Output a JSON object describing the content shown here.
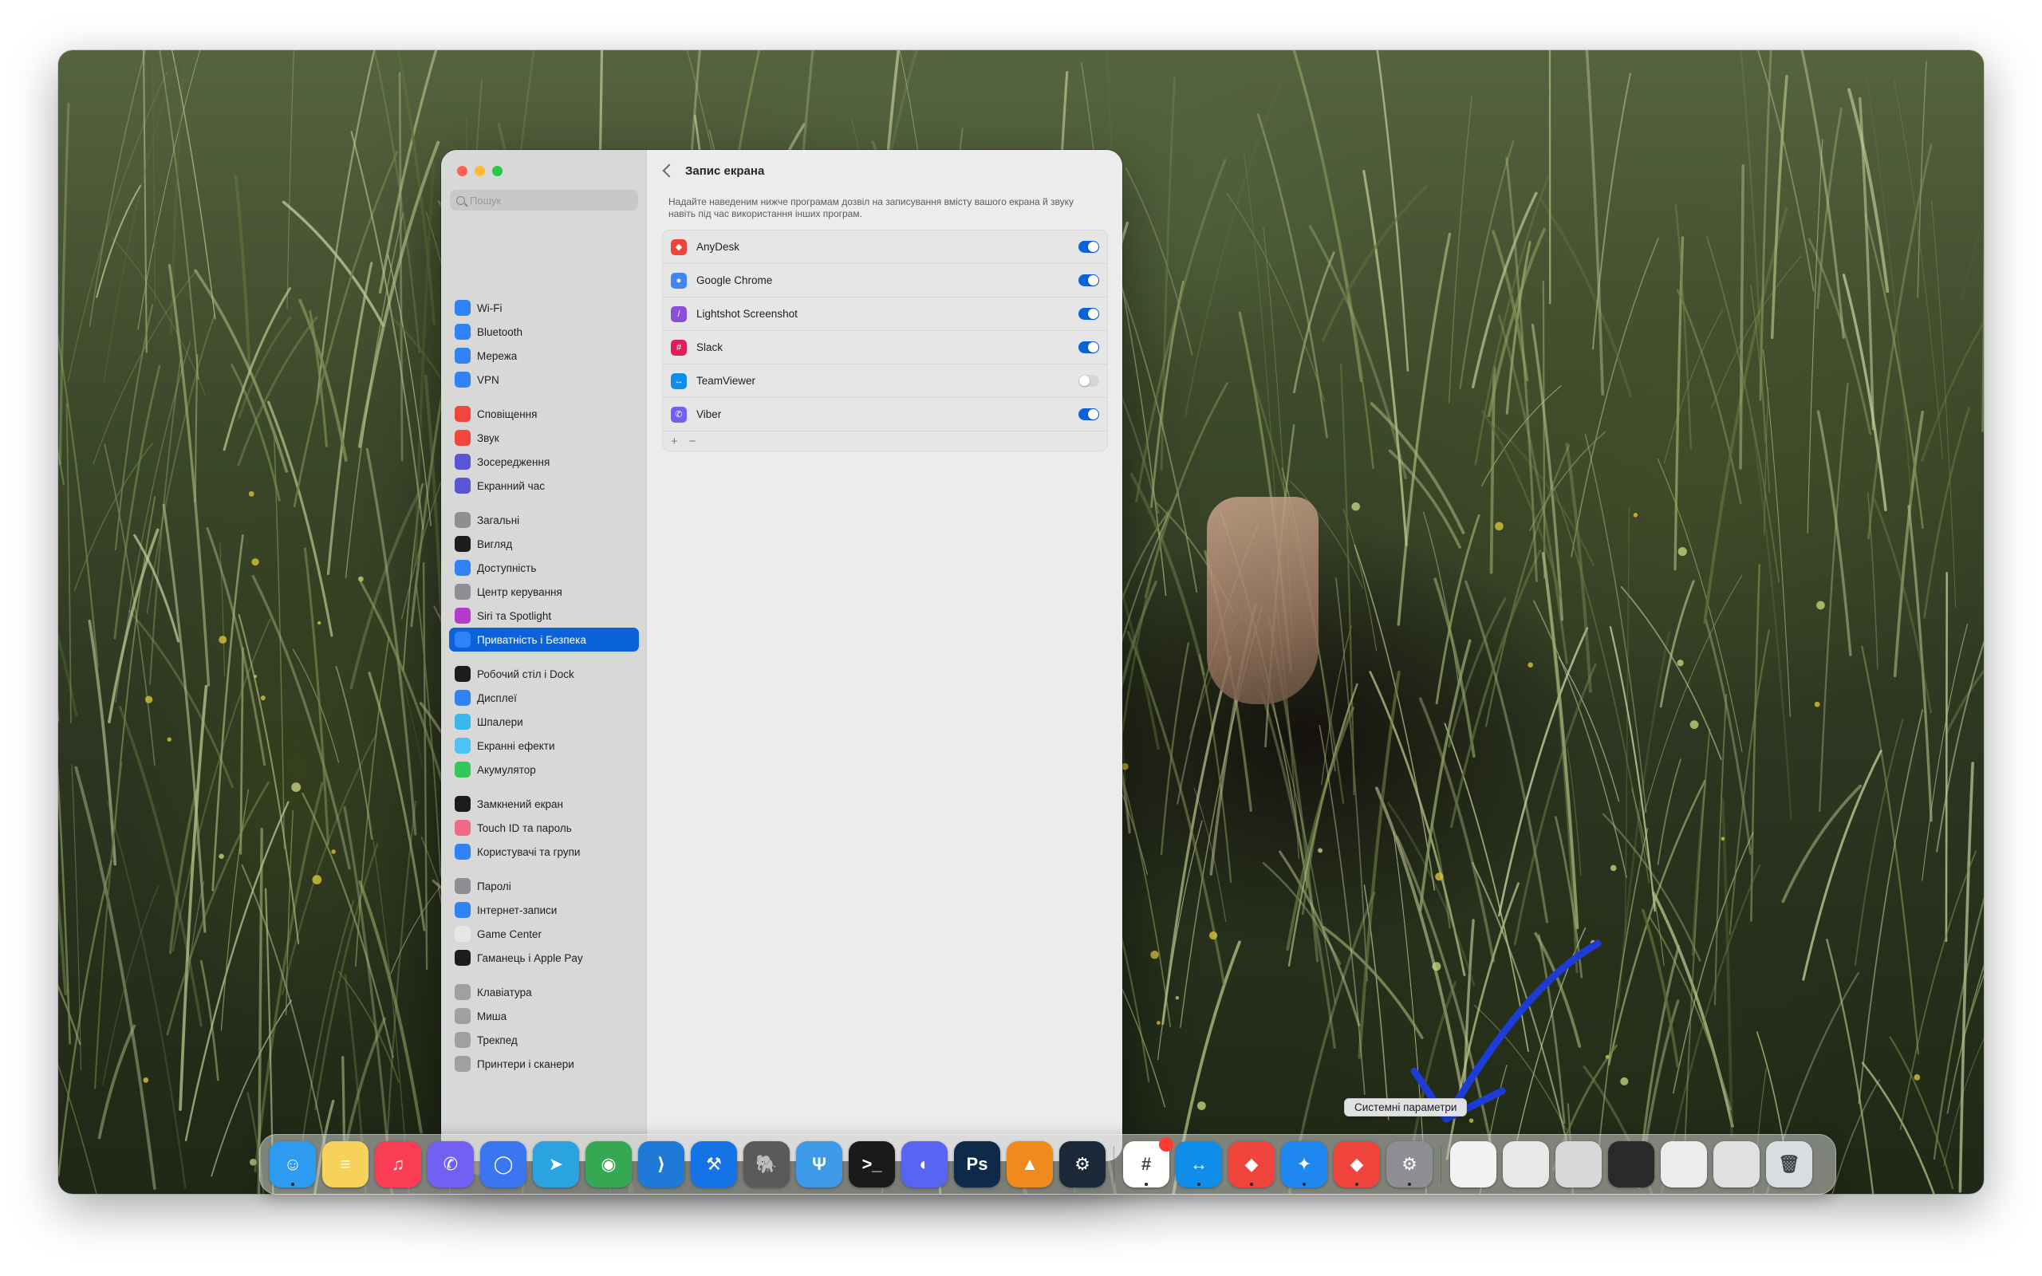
{
  "sidebar": {
    "search_placeholder": "Пошук",
    "groups": [
      [
        {
          "label": "Wi-Fi",
          "icon": "wifi-icon",
          "color": "#2f83f6"
        },
        {
          "label": "Bluetooth",
          "icon": "bluetooth-icon",
          "color": "#2f83f6"
        },
        {
          "label": "Мережа",
          "icon": "globe-icon",
          "color": "#2f83f6"
        },
        {
          "label": "VPN",
          "icon": "vpn-icon",
          "color": "#2f83f6"
        }
      ],
      [
        {
          "label": "Сповіщення",
          "icon": "bell-icon",
          "color": "#f2463d"
        },
        {
          "label": "Звук",
          "icon": "speaker-icon",
          "color": "#f2463d"
        },
        {
          "label": "Зосередження",
          "icon": "moon-icon",
          "color": "#5856d6"
        },
        {
          "label": "Екранний час",
          "icon": "hourglass-icon",
          "color": "#5856d6"
        }
      ],
      [
        {
          "label": "Загальні",
          "icon": "gear-icon",
          "color": "#8e8e93"
        },
        {
          "label": "Вигляд",
          "icon": "appearance-icon",
          "color": "#1c1c1e"
        },
        {
          "label": "Доступність",
          "icon": "accessibility-icon",
          "color": "#2f83f6"
        },
        {
          "label": "Центр керування",
          "icon": "control-center-icon",
          "color": "#8e8e93"
        },
        {
          "label": "Siri та Spotlight",
          "icon": "siri-icon",
          "color": "#b33acb"
        },
        {
          "label": "Приватність і Безпека",
          "icon": "hand-icon",
          "color": "#2f83f6",
          "active": true
        }
      ],
      [
        {
          "label": "Робочий стіл і Dock",
          "icon": "dock-icon",
          "color": "#1c1c1e"
        },
        {
          "label": "Дисплеї",
          "icon": "sun-icon",
          "color": "#2f83f6"
        },
        {
          "label": "Шпалери",
          "icon": "wallpaper-icon",
          "color": "#39b6f0"
        },
        {
          "label": "Екранні ефекти",
          "icon": "screensaver-icon",
          "color": "#4fc3f7"
        },
        {
          "label": "Акумулятор",
          "icon": "battery-icon",
          "color": "#34c759"
        }
      ],
      [
        {
          "label": "Замкнений екран",
          "icon": "lock-screen-icon",
          "color": "#1c1c1e"
        },
        {
          "label": "Touch ID та пароль",
          "icon": "fingerprint-icon",
          "color": "#f06a85"
        },
        {
          "label": "Користувачі та групи",
          "icon": "users-icon",
          "color": "#2f83f6"
        }
      ],
      [
        {
          "label": "Паролі",
          "icon": "key-icon",
          "color": "#8e8e93"
        },
        {
          "label": "Інтернет-записи",
          "icon": "at-icon",
          "color": "#2f83f6"
        },
        {
          "label": "Game Center",
          "icon": "game-center-icon",
          "color": "#e6e6e6"
        },
        {
          "label": "Гаманець і Apple Pay",
          "icon": "wallet-icon",
          "color": "#1c1c1e"
        }
      ],
      [
        {
          "label": "Клавіатура",
          "icon": "keyboard-icon",
          "color": "#a0a0a0"
        },
        {
          "label": "Миша",
          "icon": "mouse-icon",
          "color": "#a0a0a0"
        },
        {
          "label": "Трекпед",
          "icon": "trackpad-icon",
          "color": "#a0a0a0"
        },
        {
          "label": "Принтери і сканери",
          "icon": "printer-icon",
          "color": "#a0a0a0"
        }
      ]
    ]
  },
  "main": {
    "title": "Запис екрана",
    "description": "Надайте наведеним нижче програмам дозвіл на записування вмісту вашого екрана й звуку навіть під час використання інших програм.",
    "apps": [
      {
        "name": "AnyDesk",
        "enabled": true,
        "color": "#ef443b",
        "glyph": "◆"
      },
      {
        "name": "Google Chrome",
        "enabled": true,
        "color": "#4285f4",
        "glyph": "●"
      },
      {
        "name": "Lightshot Screenshot",
        "enabled": true,
        "color": "#8a4fd8",
        "glyph": "/"
      },
      {
        "name": "Slack",
        "enabled": true,
        "color": "#e01e5a",
        "glyph": "#"
      },
      {
        "name": "TeamViewer",
        "enabled": false,
        "color": "#0e8ee9",
        "glyph": "↔"
      },
      {
        "name": "Viber",
        "enabled": true,
        "color": "#7360f2",
        "glyph": "✆"
      }
    ],
    "add_glyph": "+",
    "remove_glyph": "−"
  },
  "tooltip": "Системні параметри",
  "dock": [
    {
      "name": "finder",
      "color": "#2d9bf0",
      "glyph": "☺",
      "dot": true
    },
    {
      "name": "notes",
      "color": "#f6d25a",
      "glyph": "≡",
      "dot": false
    },
    {
      "name": "music",
      "color": "#fa3c55",
      "glyph": "♫",
      "dot": false
    },
    {
      "name": "viber",
      "color": "#7360f2",
      "glyph": "✆",
      "dot": false
    },
    {
      "name": "signal",
      "color": "#3a76f0",
      "glyph": "◯",
      "dot": false
    },
    {
      "name": "telegram",
      "color": "#2aa3e0",
      "glyph": "➤",
      "dot": false
    },
    {
      "name": "chrome",
      "color": "#34a853",
      "glyph": "◉",
      "dot": false
    },
    {
      "name": "vscode",
      "color": "#1e7ad6",
      "glyph": "⟩",
      "dot": false
    },
    {
      "name": "xcode",
      "color": "#1573e8",
      "glyph": "⚒",
      "dot": false
    },
    {
      "name": "tableplus",
      "color": "#5a5a5a",
      "glyph": "🐘",
      "dot": false
    },
    {
      "name": "fork",
      "color": "#3c9ae8",
      "glyph": "Ψ",
      "dot": false
    },
    {
      "name": "terminal",
      "color": "#1a1a1a",
      "glyph": ">_",
      "dot": false
    },
    {
      "name": "discord",
      "color": "#5865f2",
      "glyph": "◐",
      "dot": false
    },
    {
      "name": "photoshop",
      "color": "#0e2a4a",
      "glyph": "Ps",
      "dot": false
    },
    {
      "name": "vlc",
      "color": "#f08a1c",
      "glyph": "▲",
      "dot": false
    },
    {
      "name": "steam",
      "color": "#1b2838",
      "glyph": "⚙",
      "dot": false
    },
    {
      "name": "slack",
      "color": "#ffffff",
      "glyph": "#",
      "dot": true,
      "badge": true
    },
    {
      "name": "teamviewer",
      "color": "#0e8ee9",
      "glyph": "↔",
      "dot": true
    },
    {
      "name": "anydesk",
      "color": "#ef443b",
      "glyph": "◆",
      "dot": true
    },
    {
      "name": "safari",
      "color": "#1e88f0",
      "glyph": "✦",
      "dot": true
    },
    {
      "name": "anydesk-2",
      "color": "#ef443b",
      "glyph": "◆",
      "dot": true
    },
    {
      "name": "system-settings",
      "color": "#8e8e93",
      "glyph": "⚙",
      "dot": true
    },
    {
      "name": "window-preview-1",
      "color": "#f2f2f2",
      "glyph": "",
      "dot": false
    },
    {
      "name": "window-preview-2",
      "color": "#e8e8e8",
      "glyph": "",
      "dot": false
    },
    {
      "name": "window-preview-3",
      "color": "#d8d8d8",
      "glyph": "",
      "dot": false
    },
    {
      "name": "window-preview-4",
      "color": "#2a2a2a",
      "glyph": "",
      "dot": false
    },
    {
      "name": "window-preview-5",
      "color": "#ececec",
      "glyph": "",
      "dot": false
    },
    {
      "name": "window-preview-6",
      "color": "#e0e0e0",
      "glyph": "",
      "dot": false
    },
    {
      "name": "trash",
      "color": "#d8dde2",
      "glyph": "🗑",
      "dot": false
    }
  ]
}
